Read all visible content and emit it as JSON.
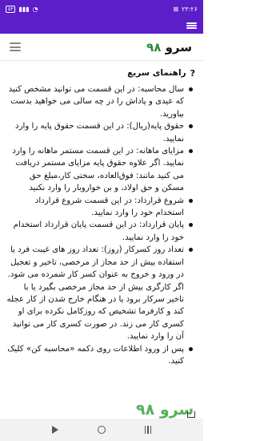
{
  "status_bar": {
    "time": "۲۳:۲۶",
    "battery": "۵۳",
    "signal_glyph": "▮▮▮",
    "wifi_glyph": "◔",
    "notif_glyph": "⊠"
  },
  "header": {
    "logo_text": "سرو",
    "logo_number": "۹۸"
  },
  "guide": {
    "title": "راهنمای سریع",
    "items": [
      "سال محاسبه: در این قسمت می توانید مشخص کنید که عیدی و پاداش را در چه سالی می خواهید بدست بیاورید.",
      "حقوق پایه(ریال): در این قسمت حقوق پایه را وارد نمایید.",
      "مزایای ماهانه: در این قسمت مستمر ماهانه را وارد نمایید. اگر علاوه حقوق پایه مزایای مستمر دریافت می کنید مانند: فوق‌العاده، سختی کار،مبلغ حق مسکن و حق اولاد، و بن خواروبار را وارد نکنید",
      "شروع قرارداد: در این قسمت شروع قرارداد استخدام خود را وارد نمایید.",
      "پایان قرارداد: در این قسمت پایان قرارداد استخدام خود را وارد نمایید.",
      "تعداد روز کسرکار (روز): تعداد روز های غیبت فرد یا استفاده بیش از حد مجاز از مرخصی، تاخیر و تعجیل در ورود و خروج به عنوان کسر کار شمرده می شود. اگر کارگری بیش از حد مجاز مرخصی بگیرد یا با تاخیر سرکار برود یا در هنگام خارج شدن از کار عجله کند و کارفرما تشخیص که روزکامل نکرده برای او کسری کار می زند. در صورت کسری کار می توانید آن را وارد نمایید.",
      "پس از ورود اطلاعات روی دکمه «محاسبه کن» کلیک کنید."
    ]
  },
  "watermark": "سرو ۹۸"
}
